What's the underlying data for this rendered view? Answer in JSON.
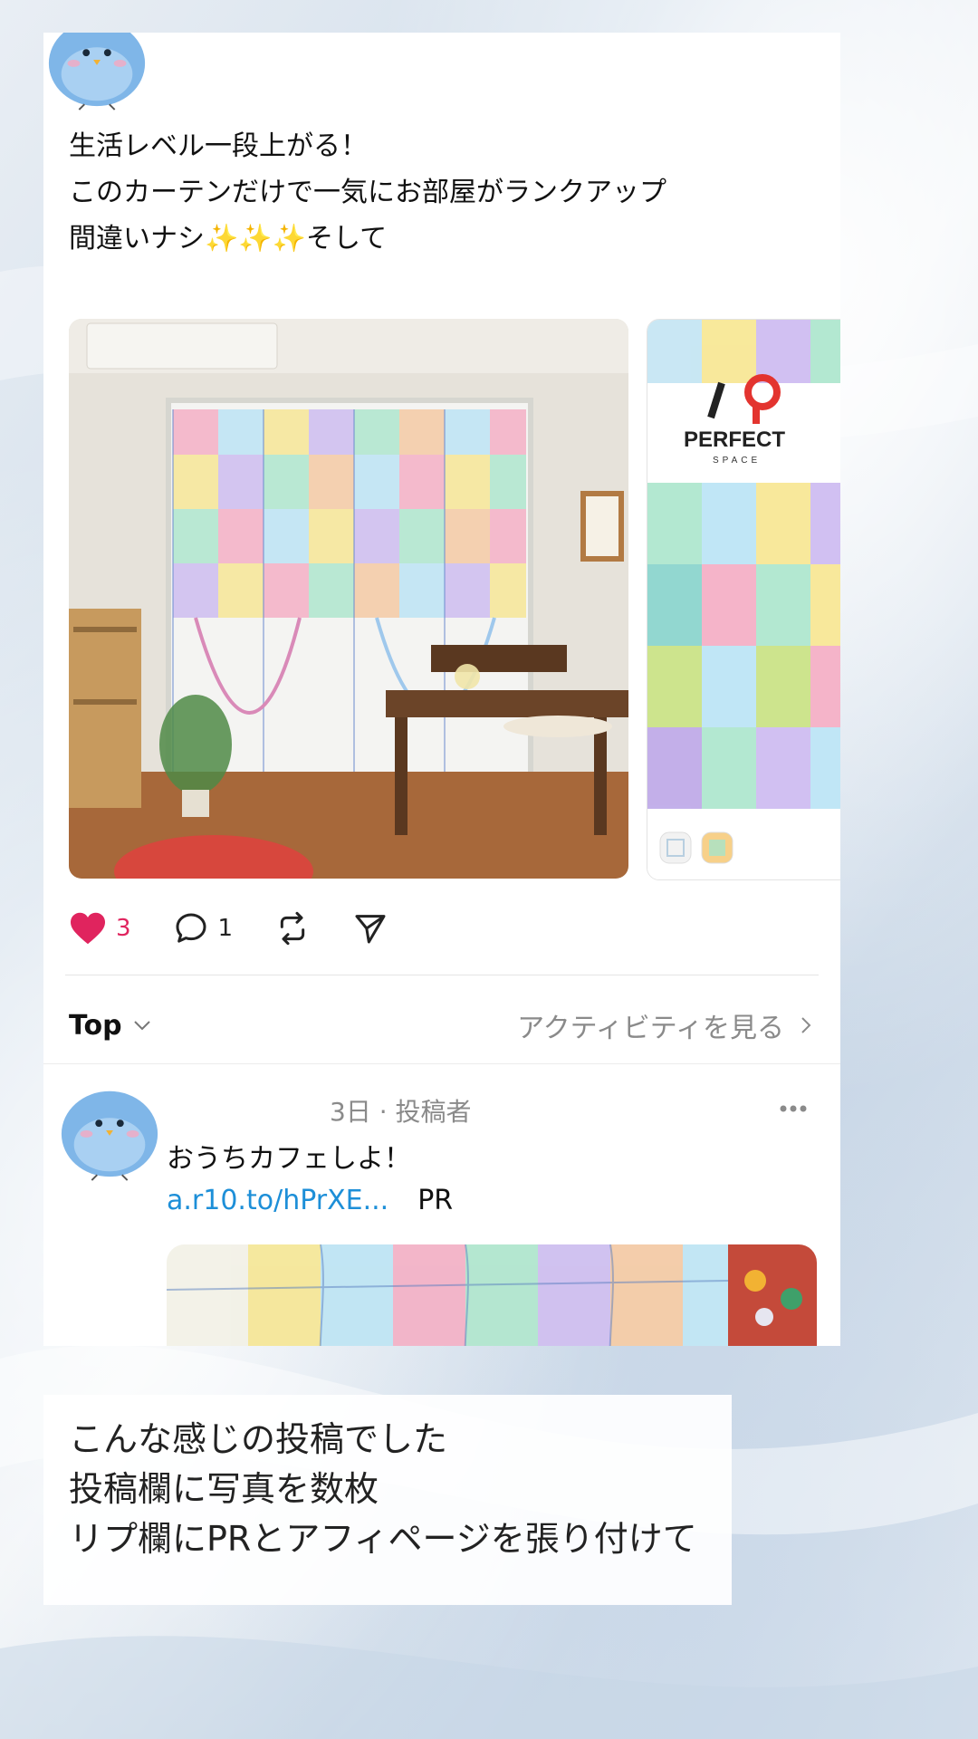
{
  "post": {
    "lines": [
      "生活レベル一段上がる！",
      "このカーテンだけで一気にお部屋がランクアップ",
      "間違いナシ✨✨✨そして"
    ],
    "brand_logo_text": "PERFECT",
    "brand_logo_sub": "SPACE"
  },
  "actions": {
    "like_count": "3",
    "comment_count": "1"
  },
  "thread": {
    "sort_label": "Top",
    "activity_label": "アクティビティを見る"
  },
  "reply": {
    "meta": "3日 · 投稿者",
    "text": "おうちカフェしよ！",
    "link": "a.r10.to/hPrXE...",
    "tag": "PR"
  },
  "caption": {
    "lines": [
      "こんな感じの投稿でした",
      "投稿欄に写真を数枚",
      "リプ欄にPRとアフィページを張り付けて"
    ]
  },
  "colors": {
    "like": "#e0245e",
    "link": "#1d8fd8",
    "muted": "#8a8a8a",
    "avatar_bird": "#7fb6e8"
  },
  "icons": {
    "like": "heart-icon",
    "comment": "comment-icon",
    "repost": "repost-icon",
    "share": "send-icon",
    "more": "more-icon",
    "sort": "chevron-down-icon",
    "activity": "chevron-right-icon"
  }
}
